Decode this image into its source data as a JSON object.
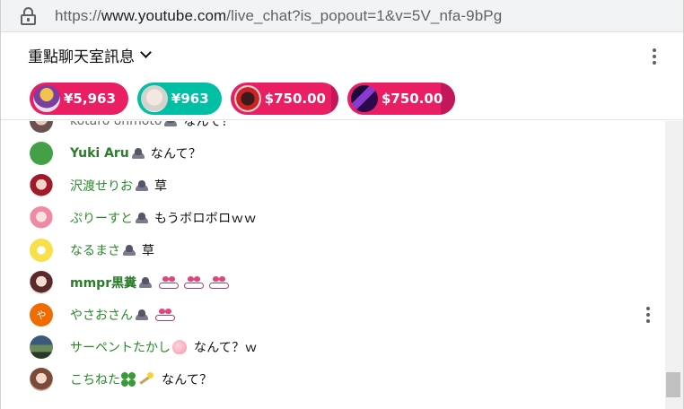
{
  "browser": {
    "url_prefix": "https://",
    "url_host": "www.youtube.com",
    "url_path": "/live_chat?is_popout=1&v=5V_nfa-9bPg"
  },
  "header": {
    "title": "重點聊天室訊息"
  },
  "tickers": [
    {
      "amount": "¥5,963",
      "color": "#e91e63"
    },
    {
      "amount": "¥963",
      "color": "#00bfa5"
    },
    {
      "amount": "$750.00",
      "color": "#e91e63"
    },
    {
      "amount": "$750.00",
      "color": "#e91e63"
    }
  ],
  "messages": [
    {
      "author": "kotaro ohmoto",
      "text": "なんて？"
    },
    {
      "author": "Yuki Aru",
      "text": "なんて？"
    },
    {
      "author": "沢渡せりお",
      "text": "草"
    },
    {
      "author": "ぷりーすと",
      "text": "もうボロボロｗｗ"
    },
    {
      "author": "なるまさ",
      "text": "草"
    },
    {
      "author": "mmpr黒糞",
      "text": ""
    },
    {
      "author": "やさおさん",
      "text": ""
    },
    {
      "author": "サーペントたかし",
      "text": "なんて？ｗ"
    },
    {
      "author": "こちねた",
      "text": "なんて？"
    }
  ],
  "avatars": {
    "yasao_initial": "や"
  },
  "colors": {
    "author_green": "#2b7d2b",
    "ticker_pink": "#e91e63",
    "ticker_teal": "#00bfa5"
  }
}
